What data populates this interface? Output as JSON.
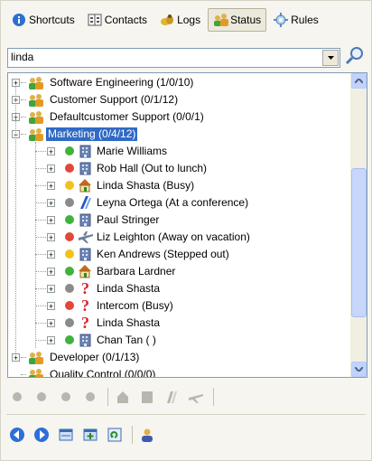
{
  "toolbar": {
    "tabs": [
      {
        "label": "Shortcuts",
        "icon": "info-icon"
      },
      {
        "label": "Contacts",
        "icon": "address-book-icon"
      },
      {
        "label": "Logs",
        "icon": "logs-icon"
      },
      {
        "label": "Status",
        "icon": "status-people-icon",
        "active": true
      },
      {
        "label": "Rules",
        "icon": "rules-icon"
      }
    ]
  },
  "search": {
    "value": "linda",
    "placeholder": ""
  },
  "tree": {
    "groups": [
      {
        "label": "Software Engineering   (1/0/10)"
      },
      {
        "label": "Customer Support   (0/1/12)"
      },
      {
        "label": "Defaultcustomer Support   (0/0/1)"
      },
      {
        "label": "Marketing   (0/4/12)",
        "selected": true
      },
      {
        "label": "Developer   (0/1/13)"
      },
      {
        "label": "Quality Control   (0/0/0)"
      }
    ],
    "members": [
      {
        "label": "Marie Williams",
        "status": "green",
        "location": "building"
      },
      {
        "label": "Rob Hall (Out to lunch)",
        "status": "red",
        "location": "building"
      },
      {
        "label": "Linda Shasta (Busy)",
        "status": "yellow",
        "location": "home"
      },
      {
        "label": "Leyna Ortega (At a conference)",
        "status": "gray",
        "location": "pen"
      },
      {
        "label": "Paul Stringer",
        "status": "green",
        "location": "building"
      },
      {
        "label": "Liz Leighton (Away on vacation)",
        "status": "red",
        "location": "plane"
      },
      {
        "label": "Ken Andrews (Stepped out)",
        "status": "yellow",
        "location": "building"
      },
      {
        "label": "Barbara Lardner",
        "status": "green",
        "location": "home"
      },
      {
        "label": "Linda Shasta",
        "status": "gray",
        "location": "unknown"
      },
      {
        "label": "Intercom (Busy)",
        "status": "red",
        "location": "unknown"
      },
      {
        "label": "Linda Shasta",
        "status": "gray",
        "location": "unknown"
      },
      {
        "label": "Chan Tan ( )",
        "status": "green",
        "location": "building"
      }
    ]
  },
  "status_bar": {
    "status_icons": [
      "dot-icon",
      "dot-icon",
      "dot-icon",
      "dot-icon"
    ],
    "location_icons": [
      "building-icon",
      "book-icon",
      "pen-icon",
      "plane-icon"
    ]
  },
  "action_bar": {
    "icons": [
      "back-icon",
      "forward-icon",
      "window-icon",
      "add-window-icon",
      "refresh-icon",
      "user-icon"
    ]
  },
  "colors": {
    "green": "#3fb33c",
    "red": "#e3463a",
    "yellow": "#f2c21a",
    "gray": "#8b8b8b",
    "selection": "#316ac5"
  }
}
